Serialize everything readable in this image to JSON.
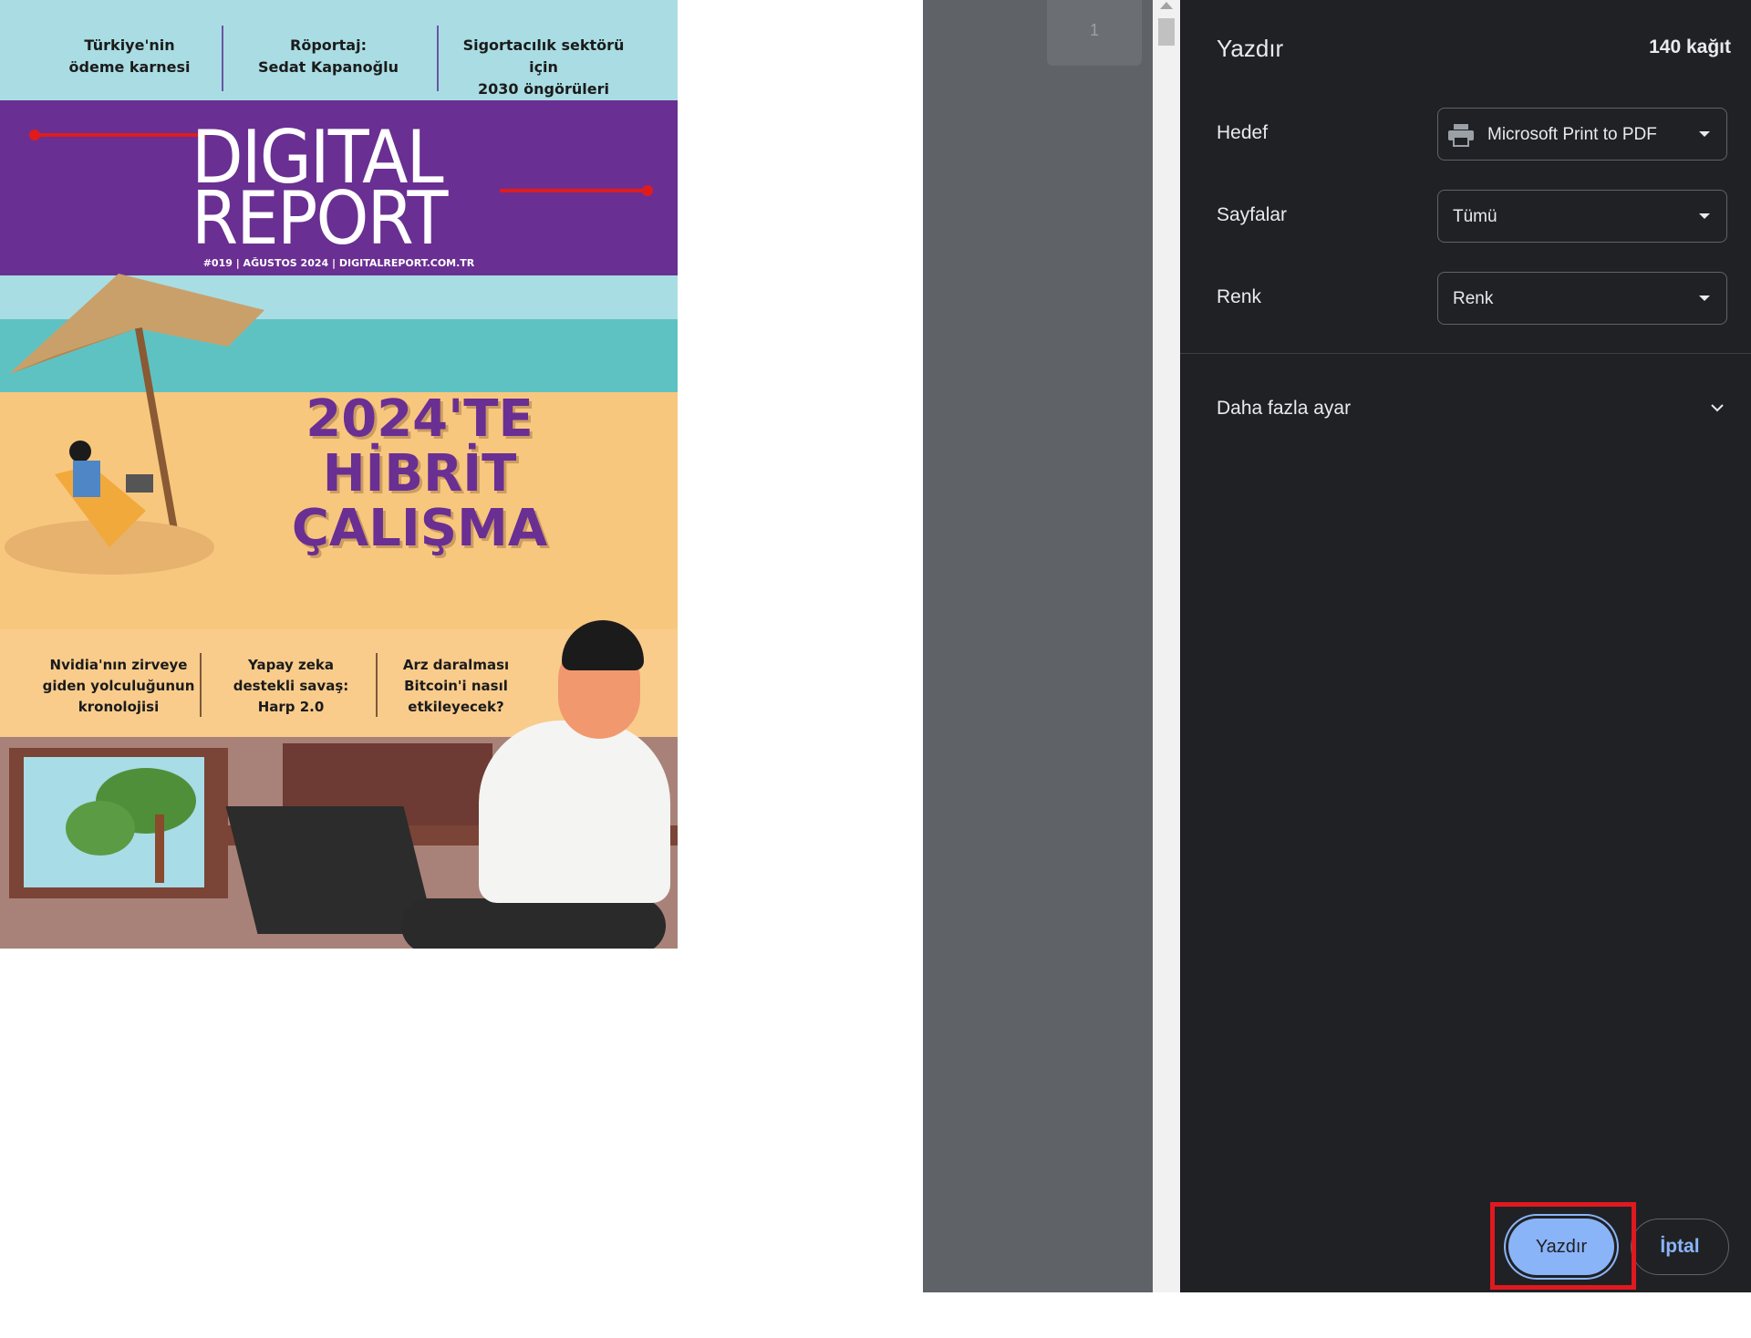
{
  "cover": {
    "top_stories": [
      {
        "line1": "Türkiye'nin",
        "line2": "ödeme karnesi"
      },
      {
        "line1": "Röportaj:",
        "line2": "Sedat Kapanoğlu"
      },
      {
        "line1": "Sigortacılık sektörü için",
        "line2": "2030 öngörüleri"
      }
    ],
    "masthead_line1": "DIGITAL",
    "masthead_line2": "REPORT",
    "issue_line": "#019 | AĞUSTOS 2024 | DIGITALREPORT.COM.TR",
    "headline": [
      "2024'TE",
      "HİBRİT",
      "ÇALIŞMA"
    ],
    "bottom_stories": [
      {
        "line1": "Nvidia'nın zirveye",
        "line2": "giden yolculuğunun",
        "line3": "kronolojisi"
      },
      {
        "line1": "Yapay zeka",
        "line2": "destekli savaş:",
        "line3": "Harp 2.0"
      },
      {
        "line1": "Arz daralması",
        "line2": "Bitcoin'i nasıl",
        "line3": "etkileyecek?"
      }
    ],
    "colors": {
      "purple": "#6a2f92",
      "red_accent": "#e11b1b"
    }
  },
  "preview": {
    "page_number": "1"
  },
  "print_panel": {
    "title": "Yazdır",
    "sheet_count": "140 kağıt",
    "destination_label": "Hedef",
    "destination_value": "Microsoft Print to PDF",
    "destination_icon": "printer-icon",
    "pages_label": "Sayfalar",
    "pages_value": "Tümü",
    "color_label": "Renk",
    "color_value": "Renk",
    "more_settings_label": "Daha fazla ayar",
    "print_button": "Yazdır",
    "cancel_button": "İptal",
    "accent_color": "#8ab4f8",
    "highlight_color": "#e0191f"
  }
}
